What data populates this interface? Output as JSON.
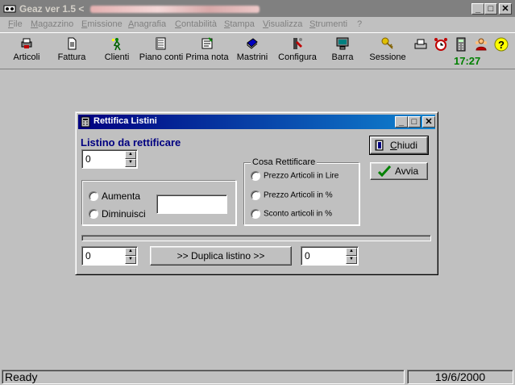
{
  "app": {
    "title": "Geaz ver 1.5 <",
    "close_char": "<"
  },
  "caption_buttons": {
    "minimize": "_",
    "maximize": "□",
    "close": "✕"
  },
  "menu": [
    {
      "label": "File",
      "key": "F",
      "rest": "ile"
    },
    {
      "label": "Magazzino",
      "key": "M",
      "rest": "agazzino"
    },
    {
      "label": "Emissione",
      "key": "E",
      "rest": "missione"
    },
    {
      "label": "Anagrafia",
      "key": "A",
      "rest": "nagrafia"
    },
    {
      "label": "Contabilità",
      "key": "C",
      "rest": "ontabilità"
    },
    {
      "label": "Stampa",
      "key": "S",
      "rest": "tampa"
    },
    {
      "label": "Visualizza",
      "key": "V",
      "rest": "isualizza"
    },
    {
      "label": "Strumenti",
      "key": "S",
      "rest": "trumenti"
    },
    {
      "label": "?",
      "key": "",
      "rest": "?"
    }
  ],
  "toolbar": {
    "articoli": "Articoli",
    "fattura": "Fattura",
    "clienti": "Clienti",
    "piano_conti": "Piano conti",
    "prima_nota": "Prima nota",
    "mastrini": "Mastrini",
    "configura": "Configura",
    "barra": "Barra",
    "sessione": "Sessione"
  },
  "clock": "17:27",
  "status": {
    "text": "Ready",
    "date": "19/6/2000"
  },
  "dialog": {
    "title": "Rettifica Listini",
    "listino_label": "Listino da rettificare",
    "listino_value": "0",
    "aumenta": "Aumenta",
    "diminuisci": "Diminuisci",
    "percent_value": "",
    "cosa_legend": "Cosa Rettificare",
    "opt_lire": "Prezzo Articoli in Lire",
    "opt_percent": "Prezzo Articoli in %",
    "opt_sconto": "Sconto articoli in %",
    "chiudi": "Chiudi",
    "chiudi_key": "C",
    "chiudi_rest": "hiudi",
    "avvia": "Avvia",
    "duplica": ">> Duplica listino >>",
    "from_value": "0",
    "to_value": "0",
    "progress": 0
  },
  "colors": {
    "face": "#c0c0c0",
    "dialog_title_start": "#000080",
    "dialog_title_end": "#1084d0",
    "label_blue": "#000080",
    "clock_green": "#008000",
    "avvia_check": "#008000"
  },
  "icons": [
    "printer-icon",
    "document-icon",
    "person-icon",
    "pages-icon",
    "notepad-icon",
    "book-icon",
    "config-icon",
    "monitor-icon",
    "key-icon",
    "print-icon",
    "alarm-clock-icon",
    "calculator-icon",
    "users-icon",
    "help-icon"
  ]
}
